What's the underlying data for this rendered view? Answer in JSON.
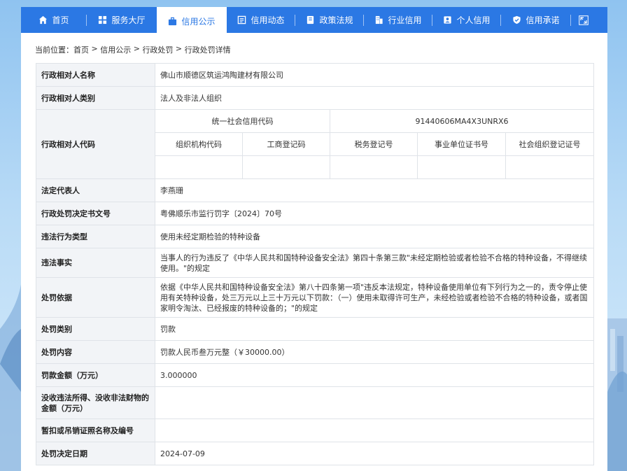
{
  "colors": {
    "nav_bg": "#2b78e4",
    "active_text": "#2b78e4",
    "label_bg": "#f2f4f7",
    "border": "#dfe3e8"
  },
  "nav": {
    "items": [
      {
        "label": "首页",
        "icon": "home-icon"
      },
      {
        "label": "服务大厅",
        "icon": "grid-icon"
      },
      {
        "label": "信用公示",
        "icon": "briefcase-icon",
        "active": true
      },
      {
        "label": "信用动态",
        "icon": "news-icon"
      },
      {
        "label": "政策法规",
        "icon": "book-icon"
      },
      {
        "label": "行业信用",
        "icon": "building-icon"
      },
      {
        "label": "个人信用",
        "icon": "id-card-icon"
      },
      {
        "label": "信用承诺",
        "icon": "shield-check-icon"
      }
    ],
    "expand_icon": "expand-icon"
  },
  "breadcrumb": {
    "prefix": "当前位置：",
    "items": [
      "首页",
      "信用公示",
      "行政处罚",
      "行政处罚详情"
    ],
    "separator": " > "
  },
  "detail": {
    "name_label": "行政相对人名称",
    "name_value": "佛山市顺德区筑运鸿陶建材有限公司",
    "category_label": "行政相对人类别",
    "category_value": "法人及非法人组织",
    "code_label": "行政相对人代码",
    "uscc_label": "统一社会信用代码",
    "uscc_value": "91440606MA4X3UNRX6",
    "sub_headers": [
      "组织机构代码",
      "工商登记码",
      "税务登记号",
      "事业单位证书号",
      "社会组织登记证号"
    ],
    "sub_values": [
      "",
      "",
      "",
      "",
      ""
    ],
    "rows": [
      {
        "label": "法定代表人",
        "value": "李燕珊"
      },
      {
        "label": "行政处罚决定书文号",
        "value": "粤佛顺乐市监行罚字〔2024〕70号"
      },
      {
        "label": "违法行为类型",
        "value": "使用未经定期检验的特种设备"
      },
      {
        "label": "违法事实",
        "value": "当事人的行为违反了《中华人民共和国特种设备安全法》第四十条第三款\"未经定期检验或者检验不合格的特种设备，不得继续使用。\"的规定"
      },
      {
        "label": "处罚依据",
        "value": "依据《中华人民共和国特种设备安全法》第八十四条第一项\"违反本法规定，特种设备使用单位有下列行为之一的，责令停止使用有关特种设备，处三万元以上三十万元以下罚款：（一）使用未取得许可生产，未经检验或者检验不合格的特种设备，或者国家明令淘汰、已经报废的特种设备的；\"的规定"
      },
      {
        "label": "处罚类别",
        "value": "罚款"
      },
      {
        "label": "处罚内容",
        "value": "罚款人民币叁万元整（￥30000.00）"
      },
      {
        "label": "罚款金额（万元）",
        "value": "3.000000"
      },
      {
        "label": "没收违法所得、没收非法财物的金额（万元）",
        "value": ""
      },
      {
        "label": "暂扣或吊销证照名称及编号",
        "value": ""
      },
      {
        "label": "处罚决定日期",
        "value": "2024-07-09"
      }
    ]
  }
}
